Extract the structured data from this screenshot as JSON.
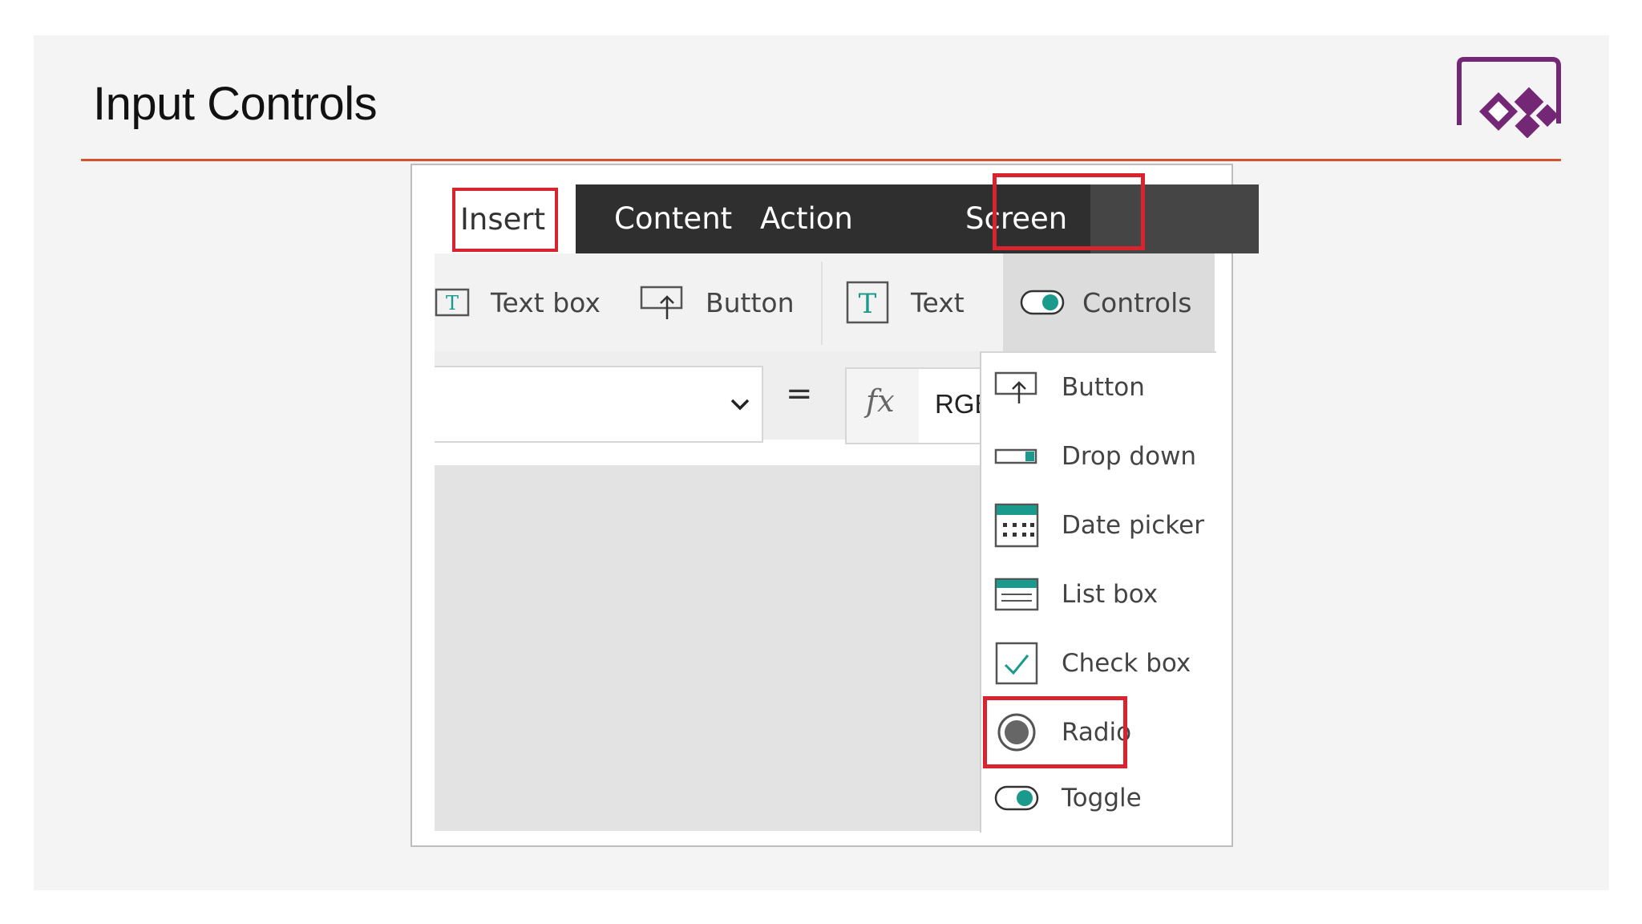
{
  "slide": {
    "title": "Input Controls",
    "accent_color": "#d4532c",
    "logo_icon": "powerapps-logo-icon"
  },
  "tabs": [
    {
      "label": "Insert",
      "selected": true
    },
    {
      "label": "Content"
    },
    {
      "label": "Action"
    },
    {
      "label": "Screen"
    }
  ],
  "ribbon": {
    "items": [
      {
        "label": "Text box",
        "icon": "text-box-icon"
      },
      {
        "label": "Button",
        "icon": "button-icon"
      },
      {
        "label": "Text",
        "icon": "text-icon"
      },
      {
        "label": "Controls",
        "icon": "toggle-icon"
      }
    ]
  },
  "formula_bar": {
    "property_value": "",
    "equals": "=",
    "fx": "fx",
    "formula": "RGBA"
  },
  "controls_menu": {
    "items": [
      {
        "label": "Button",
        "icon": "button-icon"
      },
      {
        "label": "Drop down",
        "icon": "dropdown-icon"
      },
      {
        "label": "Date picker",
        "icon": "calendar-icon"
      },
      {
        "label": "List box",
        "icon": "list-box-icon"
      },
      {
        "label": "Check box",
        "icon": "checkbox-icon"
      },
      {
        "label": "Radio",
        "icon": "radio-icon"
      },
      {
        "label": "Toggle",
        "icon": "toggle-icon"
      }
    ]
  },
  "highlight_color": "#d9242f",
  "control_accent": "#1a9a8c"
}
